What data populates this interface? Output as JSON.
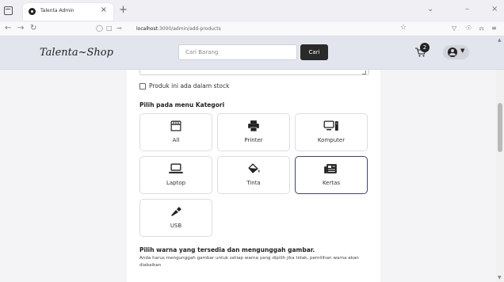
{
  "browser": {
    "tab_title": "Talenta Admin",
    "tab_close": "×",
    "new_tab": "+",
    "url_host": "localhost",
    "url_path": ":3000/admin/add-products",
    "win_minimize": "–",
    "win_close": "×"
  },
  "header": {
    "brand": "Talenta~Shop",
    "search_placeholder": "Cari Barang",
    "search_button": "Cari",
    "cart_count": "2"
  },
  "form": {
    "stock_label": "Produk ini ada dalam stock",
    "category_heading": "Pilih pada menu Kategori",
    "categories": [
      {
        "label": "All",
        "icon": "store-icon"
      },
      {
        "label": "Printer",
        "icon": "printer-icon"
      },
      {
        "label": "Komputer",
        "icon": "computer-icon"
      },
      {
        "label": "Laptop",
        "icon": "laptop-icon"
      },
      {
        "label": "Tinta",
        "icon": "ink-icon"
      },
      {
        "label": "Kertas",
        "icon": "newspaper-icon"
      },
      {
        "label": "USB",
        "icon": "usb-icon"
      }
    ],
    "selected_category": "Kertas",
    "color_heading": "Pilih warna yang tersedia dan mengunggah gambar.",
    "color_desc": "Anda harus mengunggah gambar untuk setiap warna yang dipilih jika tidak, pemilihan warna akan diabaikan"
  }
}
